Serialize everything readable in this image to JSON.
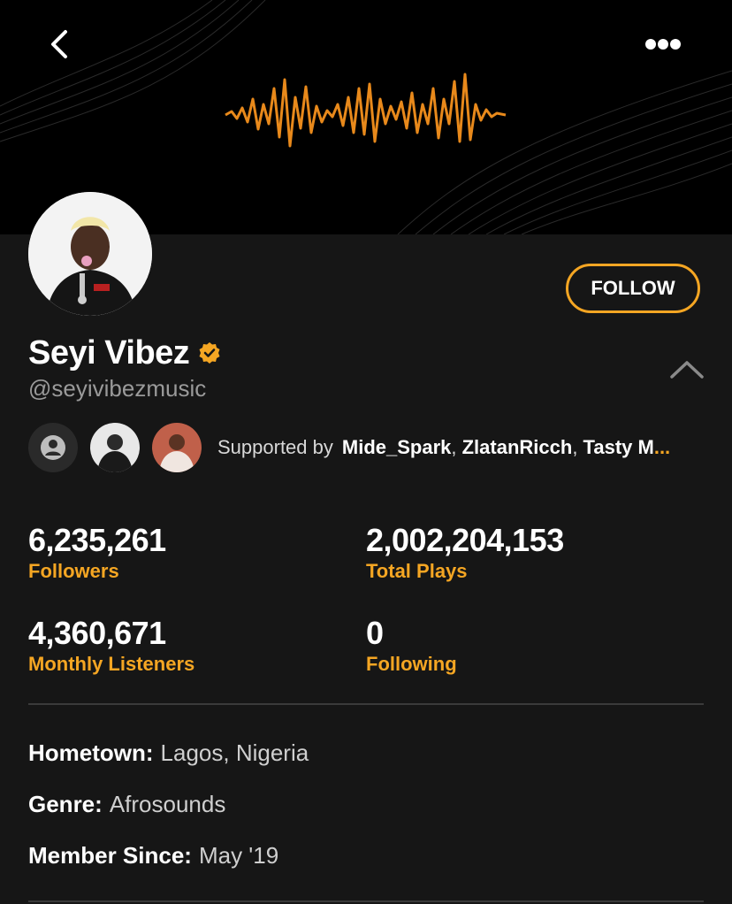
{
  "theme": {
    "accent": "#f5a623",
    "background": "#161616",
    "banner": "#000000"
  },
  "header": {
    "back_icon": "chevron-left-icon",
    "more_icon": "more-dots-icon",
    "banner_graphic": "sound-wave"
  },
  "profile": {
    "name": "Seyi Vibez",
    "verified": true,
    "handle": "@seyivibezmusic",
    "follow_label": "FOLLOW"
  },
  "supporters": {
    "label": "Supported by",
    "names": [
      "Mide_Spark",
      "ZlatanRicch",
      "Tasty M"
    ],
    "overflow": "..."
  },
  "stats": [
    {
      "value": "6,235,261",
      "label": "Followers"
    },
    {
      "value": "2,002,204,153",
      "label": "Total Plays"
    },
    {
      "value": "4,360,671",
      "label": "Monthly Listeners"
    },
    {
      "value": "0",
      "label": "Following"
    }
  ],
  "details": {
    "hometown": {
      "key": "Hometown:",
      "value": "Lagos, Nigeria"
    },
    "genre": {
      "key": "Genre:",
      "value": "Afrosounds"
    },
    "member_since": {
      "key": "Member Since:",
      "value": "May '19"
    }
  }
}
